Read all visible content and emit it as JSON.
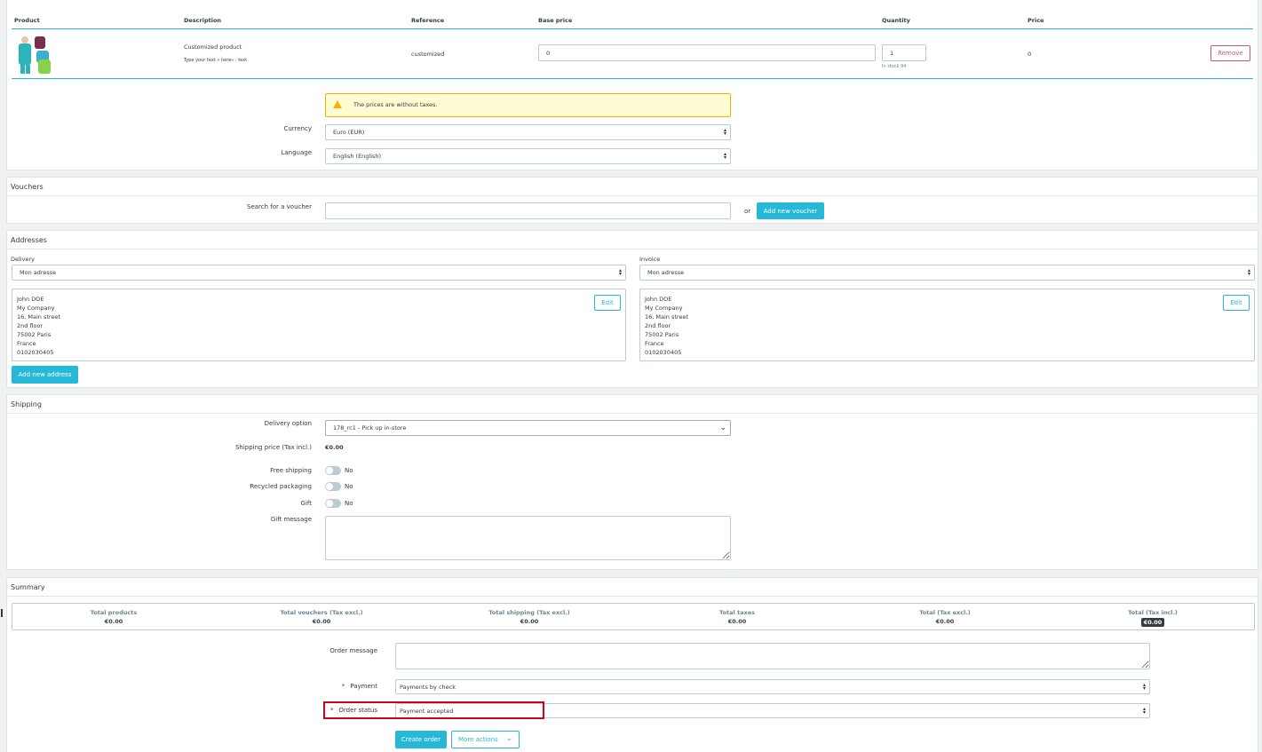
{
  "cart": {
    "headers": {
      "product": "Product",
      "description": "Description",
      "reference": "Reference",
      "base_price": "Base price",
      "quantity": "Quantity",
      "price": "Price"
    },
    "row": {
      "description": "Customized product",
      "customization": "Type your text « here» : text",
      "reference": "customized",
      "base_price": "0",
      "quantity": "1",
      "stock": "In stock 94",
      "price": "0",
      "remove_label": "Remove"
    },
    "warning": "The prices are without taxes.",
    "currency_label": "Currency",
    "currency_value": "Euro (EUR)",
    "language_label": "Language",
    "language_value": "English (English)"
  },
  "vouchers": {
    "title": "Vouchers",
    "search_label": "Search for a voucher",
    "search_value": "",
    "or": "or",
    "add_label": "Add new voucher"
  },
  "addresses": {
    "title": "Addresses",
    "delivery_label": "Delivery",
    "delivery_value": "Mon adresse",
    "invoice_label": "Invoice",
    "invoice_value": "Mon adresse",
    "edit_label": "Edit",
    "lines": [
      "John DOE",
      "My Company",
      "16, Main street",
      "2nd floor",
      "75002 Paris",
      "France",
      "0102030405"
    ],
    "add_label": "Add new address"
  },
  "shipping": {
    "title": "Shipping",
    "option_label": "Delivery option",
    "option_value": "178_rc1 - Pick up in-store",
    "price_label": "Shipping price (Tax incl.)",
    "price_value": "€0.00",
    "free_label": "Free shipping",
    "recycled_label": "Recycled packaging",
    "gift_label": "Gift",
    "no": "No",
    "gift_message_label": "Gift message"
  },
  "summary": {
    "title": "Summary",
    "totals": [
      {
        "label": "Total products",
        "value": "€0.00"
      },
      {
        "label": "Total vouchers (Tax excl.)",
        "value": "€0.00"
      },
      {
        "label": "Total shipping (Tax excl.)",
        "value": "€0.00"
      },
      {
        "label": "Total taxes",
        "value": "€0.00"
      },
      {
        "label": "Total (Tax excl.)",
        "value": "€0.00"
      },
      {
        "label": "Total (Tax incl.)",
        "value": "€0.00"
      }
    ],
    "order_message_label": "Order message",
    "payment_label": "Payment",
    "payment_value": "Payments by check",
    "status_label": "Order status",
    "status_value": "Payment accepted",
    "required_mark": "*",
    "create_label": "Create order",
    "more_label": "More actions"
  },
  "colors": {
    "primary": "#25b9d7",
    "danger": "#c05c67",
    "warning_bg": "#fffbd3",
    "highlight": "#d0021b"
  }
}
